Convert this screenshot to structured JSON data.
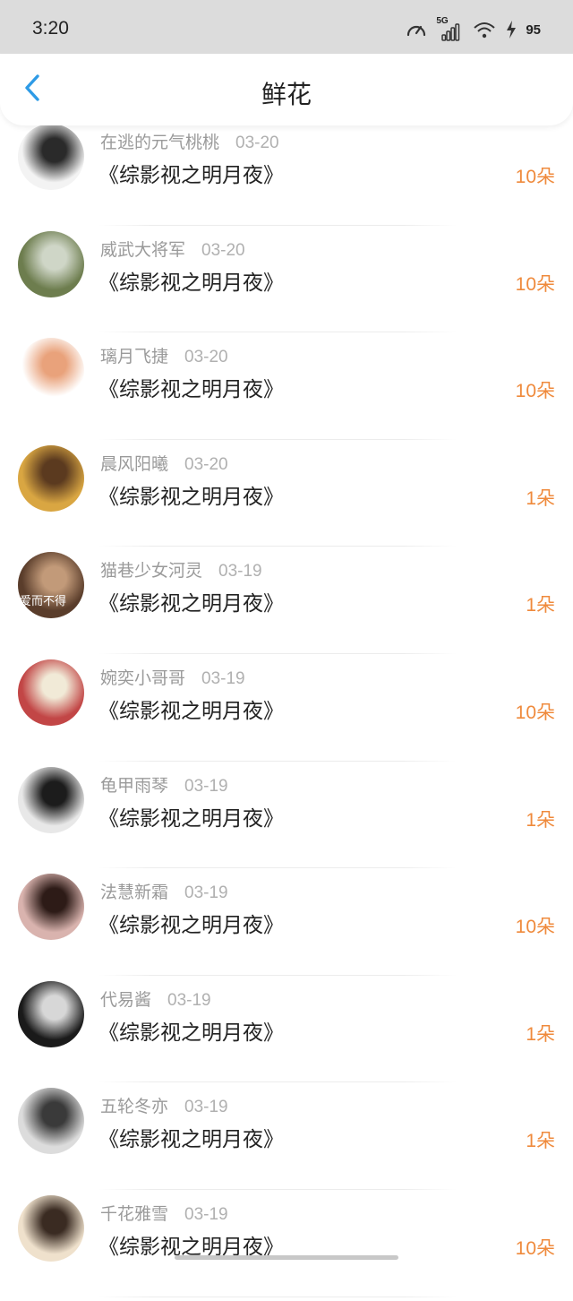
{
  "status_bar": {
    "time": "3:20",
    "network": "5G",
    "battery": "95"
  },
  "nav": {
    "title": "鲜花"
  },
  "rows": [
    {
      "user": "在逃的元气桃桃",
      "date": "03-20",
      "book": "《综影视之明月夜》",
      "count": "10朵",
      "avatar_colors": [
        "#f3f3f3",
        "#2a2a2a"
      ]
    },
    {
      "user": "威武大将军",
      "date": "03-20",
      "book": "《综影视之明月夜》",
      "count": "10朵",
      "avatar_colors": [
        "#6d7d4e",
        "#cfd6c7"
      ]
    },
    {
      "user": "璃月飞捷",
      "date": "03-20",
      "book": "《综影视之明月夜》",
      "count": "10朵",
      "avatar_colors": [
        "#ffffff",
        "#e9a27b"
      ]
    },
    {
      "user": "晨风阳曦",
      "date": "03-20",
      "book": "《综影视之明月夜》",
      "count": "1朵",
      "avatar_colors": [
        "#d9a642",
        "#5b3a1f"
      ]
    },
    {
      "user": "猫巷少女河灵",
      "date": "03-19",
      "book": "《综影视之明月夜》",
      "count": "1朵",
      "avatar_colors": [
        "#5a3d2b",
        "#c29a79"
      ],
      "avatar_text": "爱而不得"
    },
    {
      "user": "婉奕小哥哥",
      "date": "03-19",
      "book": "《综影视之明月夜》",
      "count": "10朵",
      "avatar_colors": [
        "#c24646",
        "#f1ead7"
      ]
    },
    {
      "user": "龟甲雨琴",
      "date": "03-19",
      "book": "《综影视之明月夜》",
      "count": "1朵",
      "avatar_colors": [
        "#e8e8e8",
        "#1c1c1c"
      ]
    },
    {
      "user": "法慧新霜",
      "date": "03-19",
      "book": "《综影视之明月夜》",
      "count": "10朵",
      "avatar_colors": [
        "#d9b3ae",
        "#2d1b17"
      ]
    },
    {
      "user": "代易酱",
      "date": "03-19",
      "book": "《综影视之明月夜》",
      "count": "1朵",
      "avatar_colors": [
        "#1a1a1a",
        "#d7d7d7"
      ]
    },
    {
      "user": "五轮冬亦",
      "date": "03-19",
      "book": "《综影视之明月夜》",
      "count": "1朵",
      "avatar_colors": [
        "#dcdcdc",
        "#3a3a3a"
      ]
    },
    {
      "user": "千花雅雪",
      "date": "03-19",
      "book": "《综影视之明月夜》",
      "count": "10朵",
      "avatar_colors": [
        "#efe1cc",
        "#3a2b22"
      ]
    }
  ],
  "colors": {
    "accent_blue": "#2e9be6",
    "count_orange": "#ef8a3c",
    "status_bar_bg": "#dcdcdc"
  }
}
